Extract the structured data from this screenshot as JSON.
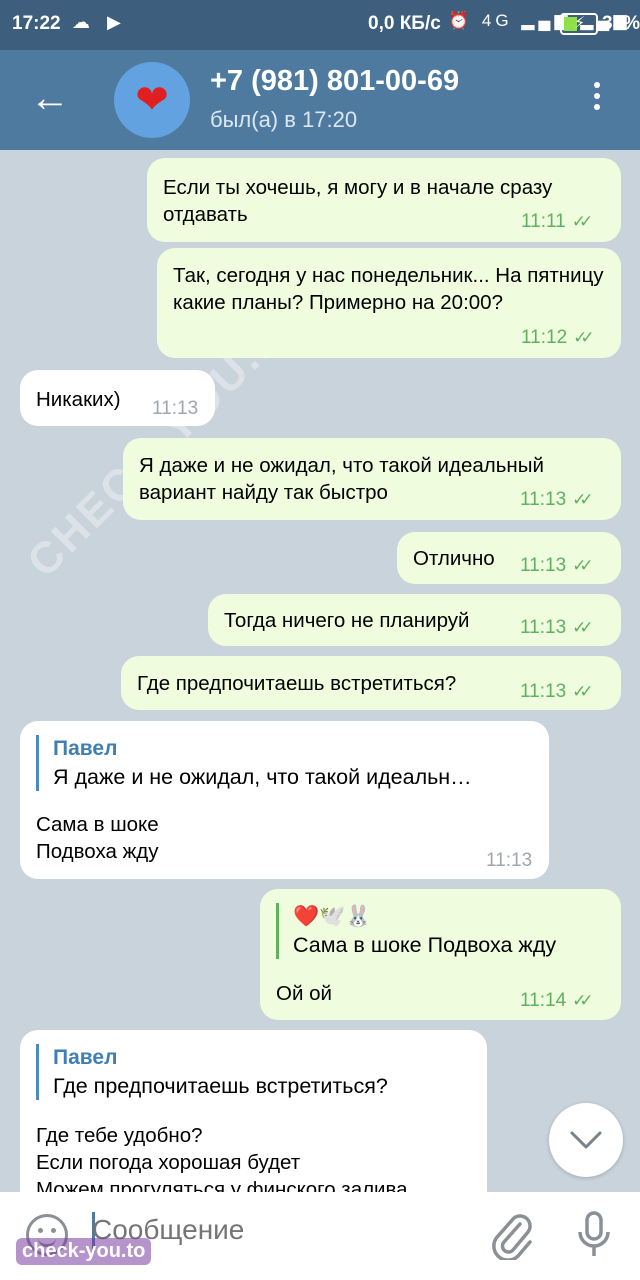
{
  "status_bar": {
    "time": "17:22",
    "left_icons": "☁ ▶",
    "network_speed": "0,0 КБ/с",
    "right_icons": "⏰ 4G ▂▄▆ ▂▄▆",
    "battery_percent": "33%"
  },
  "header": {
    "back_icon": "arrow-left-icon",
    "avatar_emoji": "❤",
    "title": "+7 (981) 801-00-69",
    "subtitle": "был(а) в 17:20",
    "menu_icon": "more-vertical-icon"
  },
  "messages": [
    {
      "dir": "out",
      "text": "Если ты хочешь, я могу и в начале сразу отдавать",
      "time": "11:11",
      "ticks": "✓✓"
    },
    {
      "dir": "out",
      "text": "Так, сегодня у нас понедельник... На пятницу какие планы? Примерно на 20:00?",
      "time": "11:12",
      "ticks": "✓✓"
    },
    {
      "dir": "in",
      "text": "Никаких)",
      "time": "11:13"
    },
    {
      "dir": "out",
      "text": "Я даже и не ожидал, что такой идеальный вариант найду так быстро",
      "time": "11:13",
      "ticks": "✓✓"
    },
    {
      "dir": "out",
      "text": "Отлично",
      "time": "11:13",
      "ticks": "✓✓"
    },
    {
      "dir": "out",
      "text": "Тогда ничего не планируй",
      "time": "11:13",
      "ticks": "✓✓"
    },
    {
      "dir": "out",
      "text": "Где предпочитаешь встретиться?",
      "time": "11:13",
      "ticks": "✓✓"
    },
    {
      "dir": "in",
      "reply_name": "Павел",
      "reply_text": "Я даже и не ожидал, что такой идеальн…",
      "text_lines": [
        "Сама в шоке",
        "Подвоха жду"
      ],
      "time": "11:13"
    },
    {
      "dir": "out",
      "reply_name": "❤️🕊️🐰",
      "reply_text": "Сама в шоке Подвоха жду",
      "text": "Ой ой",
      "time": "11:14",
      "ticks": "✓✓"
    },
    {
      "dir": "in",
      "reply_name": "Павел",
      "reply_text": "Где предпочитаешь встретиться?",
      "text_lines": [
        "Где тебе удобно?",
        "Если погода хорошая будет",
        "Можем прогуляться у финского залива"
      ]
    }
  ],
  "input": {
    "placeholder": "Сообщение",
    "emoji_icon": "smile-icon",
    "attach_icon": "paperclip-icon",
    "mic_icon": "microphone-icon"
  },
  "watermarks": {
    "bottom": "check-you.to",
    "diagonal": "CHECK-YOU.ME"
  },
  "colors": {
    "header": "#4f7aa0",
    "status_bar": "#3d5e7c",
    "outgoing_bubble": "#effdde",
    "incoming_bubble": "#ffffff",
    "tick_green": "#5fb05f",
    "reply_name_blue": "#3f7fb5"
  }
}
